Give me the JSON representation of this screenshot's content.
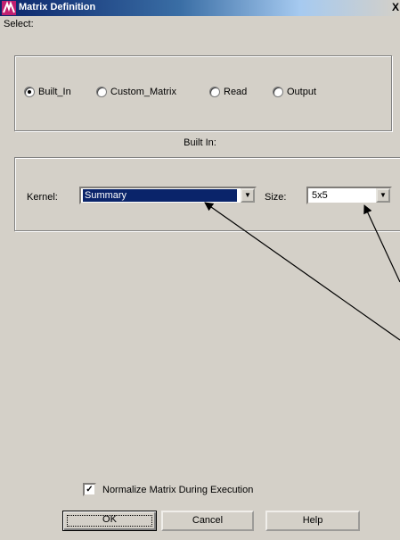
{
  "window": {
    "title": "Matrix Definition",
    "close_glyph": "X",
    "icon": "app-logo-icon"
  },
  "select": {
    "label": "Select:",
    "options": [
      {
        "label": "Built_In",
        "checked": true
      },
      {
        "label": "Custom_Matrix",
        "checked": false
      },
      {
        "label": "Read",
        "checked": false
      },
      {
        "label": "Output",
        "checked": false
      }
    ]
  },
  "builtin": {
    "heading": "Built In:",
    "kernel_label": "Kernel:",
    "kernel_value": "Summary",
    "size_label": "Size:",
    "size_value": "5x5"
  },
  "normalize": {
    "label": "Normalize Matrix During Execution",
    "checked": true,
    "check_glyph": "✓"
  },
  "buttons": {
    "ok": "OK",
    "cancel": "Cancel",
    "help": "Help"
  },
  "colors": {
    "face": "#d4d0c8",
    "title_active": "#0a246a",
    "selection": "#0a246a"
  }
}
